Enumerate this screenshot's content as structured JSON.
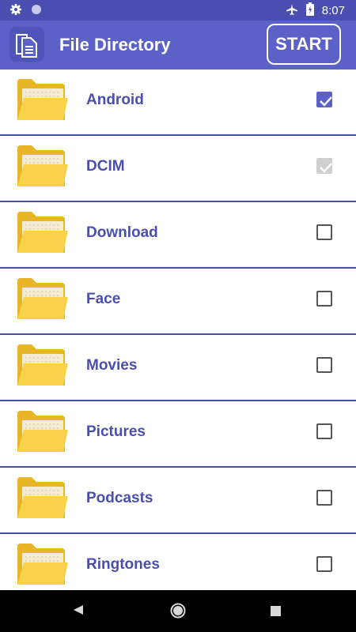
{
  "status_bar": {
    "time": "8:07",
    "icons": [
      "gear-icon",
      "circle-icon",
      "airplane-icon",
      "battery-icon"
    ]
  },
  "app_bar": {
    "title": "File Directory",
    "start_label": "START",
    "icon": "document-icon"
  },
  "folders": [
    {
      "name": "Android",
      "checked": true,
      "enabled": true
    },
    {
      "name": "DCIM",
      "checked": true,
      "enabled": false
    },
    {
      "name": "Download",
      "checked": false,
      "enabled": true
    },
    {
      "name": "Face",
      "checked": false,
      "enabled": true
    },
    {
      "name": "Movies",
      "checked": false,
      "enabled": true
    },
    {
      "name": "Pictures",
      "checked": false,
      "enabled": true
    },
    {
      "name": "Podcasts",
      "checked": false,
      "enabled": true
    },
    {
      "name": "Ringtones",
      "checked": false,
      "enabled": true
    }
  ],
  "nav_bar": {
    "icons": [
      "back-icon",
      "home-icon",
      "recents-icon"
    ]
  },
  "colors": {
    "primary": "#5c61c8",
    "primary_dark": "#4a4eb0",
    "label": "#4a4eb0",
    "folder": "#f5c63a"
  }
}
